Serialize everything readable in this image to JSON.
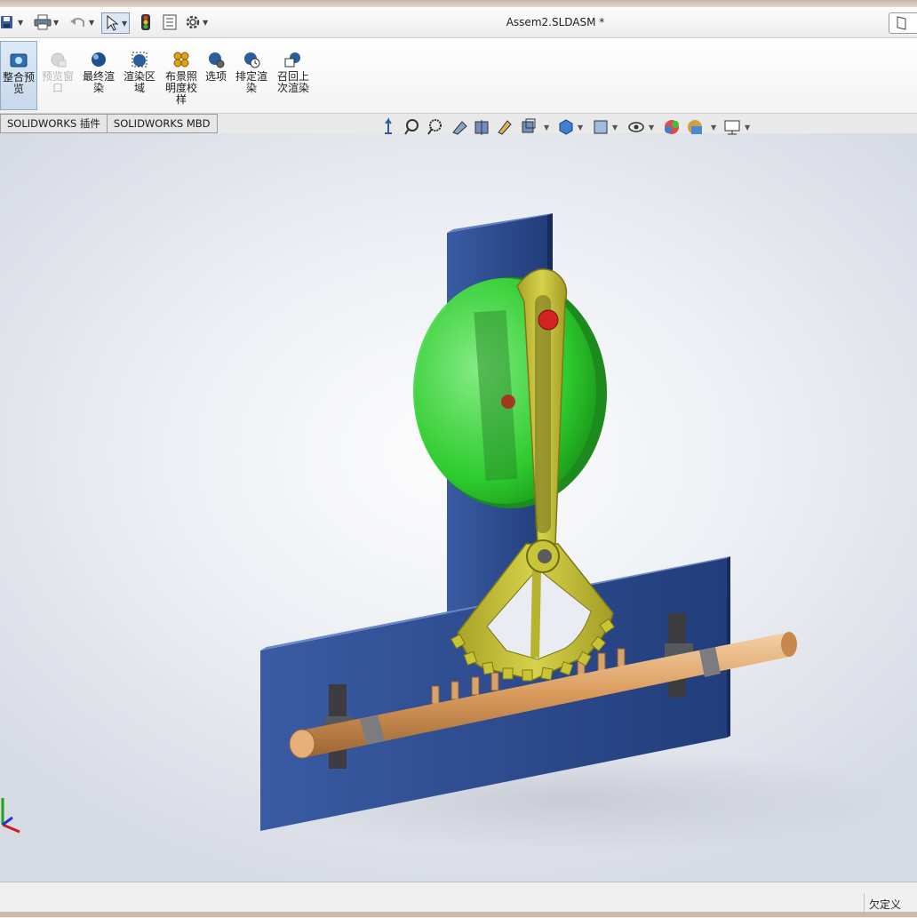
{
  "window": {
    "title": "Assem2.SLDASM *"
  },
  "ribbon": {
    "buttons": [
      {
        "label": "整合预\n览",
        "icon": "integrated-preview-icon",
        "state": "active"
      },
      {
        "label": "预览窗\n口",
        "icon": "preview-window-icon",
        "state": "disabled"
      },
      {
        "label": "最终渲\n染",
        "icon": "final-render-icon",
        "state": "normal"
      },
      {
        "label": "渲染区\n域",
        "icon": "render-region-icon",
        "state": "normal"
      },
      {
        "label": "布景照\n明度校\n样",
        "icon": "scene-illumination-proof-icon",
        "state": "normal"
      },
      {
        "label": "选项",
        "icon": "options-icon",
        "state": "normal"
      },
      {
        "label": "排定渲\n染",
        "icon": "schedule-render-icon",
        "state": "normal"
      },
      {
        "label": "召回上\n次渲染",
        "icon": "recall-last-render-icon",
        "state": "normal"
      }
    ]
  },
  "tabs": [
    {
      "label": "SOLIDWORKS 插件"
    },
    {
      "label": "SOLIDWORKS MBD"
    }
  ],
  "status": {
    "text": "欠定义"
  },
  "colors": {
    "plate": "#2d4a8a",
    "disc": "#3ecf3e",
    "lever": "#c8c436",
    "rod": "#d99a5c",
    "pin": "#cc2020"
  }
}
